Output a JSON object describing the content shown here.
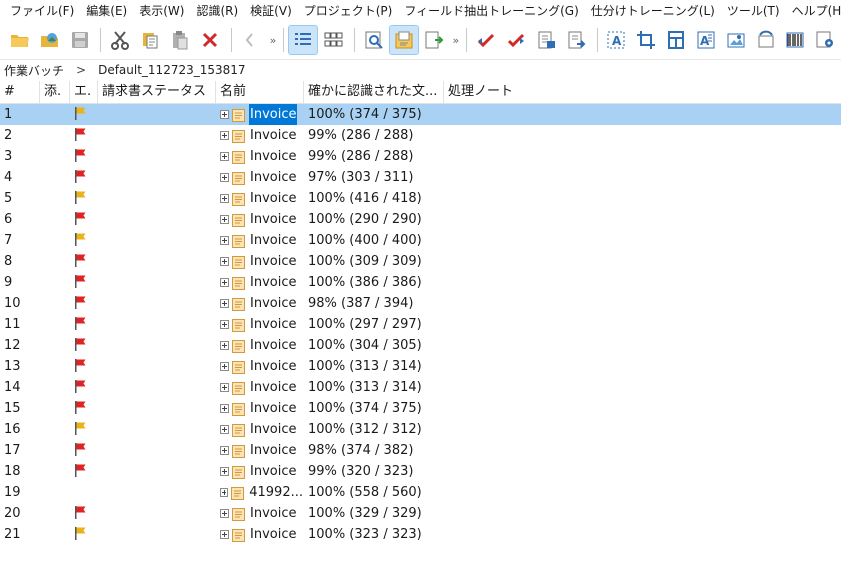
{
  "menu": [
    "ファイル(F)",
    "編集(E)",
    "表示(W)",
    "認識(R)",
    "検証(V)",
    "プロジェクト(P)",
    "フィールド抽出トレーニング(G)",
    "仕分けトレーニング(L)",
    "ツール(T)",
    "ヘルプ(H)"
  ],
  "breadcrumb": {
    "root": "作業バッチ",
    "sep": ">",
    "current": "Default_112723_153817"
  },
  "columns": {
    "num": "#",
    "attach": "添.",
    "error": "エ.",
    "status": "請求書ステータス",
    "name": "名前",
    "confidence": "確かに認識された文...",
    "notes": "処理ノート"
  },
  "colors": {
    "flag_red": "#e02424",
    "flag_yellow": "#e8b417",
    "selection": "#a9d1f3",
    "name_highlight": "#0078d7"
  },
  "rows": [
    {
      "num": "1",
      "flag": "yellow",
      "name": "Invoice",
      "conf": "100% (374 / 375)",
      "selected": true
    },
    {
      "num": "2",
      "flag": "red",
      "name": "Invoice",
      "conf": "99% (286 / 288)"
    },
    {
      "num": "3",
      "flag": "red",
      "name": "Invoice",
      "conf": "99% (286 / 288)"
    },
    {
      "num": "4",
      "flag": "red",
      "name": "Invoice",
      "conf": "97% (303 / 311)"
    },
    {
      "num": "5",
      "flag": "yellow",
      "name": "Invoice",
      "conf": "100% (416 / 418)"
    },
    {
      "num": "6",
      "flag": "red",
      "name": "Invoice",
      "conf": "100% (290 / 290)"
    },
    {
      "num": "7",
      "flag": "yellow",
      "name": "Invoice",
      "conf": "100% (400 / 400)"
    },
    {
      "num": "8",
      "flag": "red",
      "name": "Invoice",
      "conf": "100% (309 / 309)"
    },
    {
      "num": "9",
      "flag": "red",
      "name": "Invoice",
      "conf": "100% (386 / 386)"
    },
    {
      "num": "10",
      "flag": "red",
      "name": "Invoice",
      "conf": "98% (387 / 394)"
    },
    {
      "num": "11",
      "flag": "red",
      "name": "Invoice",
      "conf": "100% (297 / 297)"
    },
    {
      "num": "12",
      "flag": "red",
      "name": "Invoice",
      "conf": "100% (304 / 305)"
    },
    {
      "num": "13",
      "flag": "red",
      "name": "Invoice",
      "conf": "100% (313 / 314)"
    },
    {
      "num": "14",
      "flag": "red",
      "name": "Invoice",
      "conf": "100% (313 / 314)"
    },
    {
      "num": "15",
      "flag": "red",
      "name": "Invoice",
      "conf": "100% (374 / 375)"
    },
    {
      "num": "16",
      "flag": "yellow",
      "name": "Invoice",
      "conf": "100% (312 / 312)"
    },
    {
      "num": "17",
      "flag": "red",
      "name": "Invoice",
      "conf": "98% (374 / 382)"
    },
    {
      "num": "18",
      "flag": "red",
      "name": "Invoice",
      "conf": "99% (320 / 323)"
    },
    {
      "num": "19",
      "flag": "none",
      "name": "41992...",
      "conf": "100% (558 / 560)"
    },
    {
      "num": "20",
      "flag": "red",
      "name": "Invoice",
      "conf": "100% (329 / 329)"
    },
    {
      "num": "21",
      "flag": "yellow",
      "name": "Invoice",
      "conf": "100% (323 / 323)"
    }
  ]
}
